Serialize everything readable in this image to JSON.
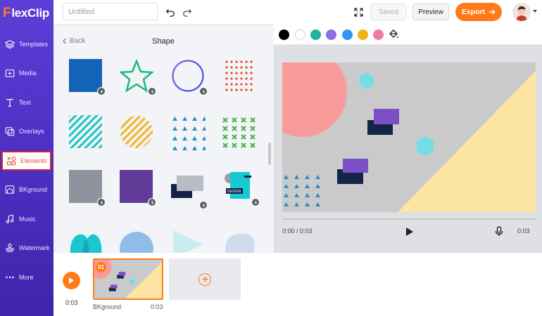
{
  "app": {
    "logo_initial": "F",
    "logo_rest": "lexClip"
  },
  "sidebar": {
    "items": [
      {
        "label": "Templates",
        "icon": "layers-icon"
      },
      {
        "label": "Media",
        "icon": "media-icon"
      },
      {
        "label": "Text",
        "icon": "text-icon"
      },
      {
        "label": "Overlays",
        "icon": "overlays-icon"
      },
      {
        "label": "Elements",
        "icon": "elements-icon",
        "active": true
      },
      {
        "label": "BKground",
        "icon": "background-icon"
      },
      {
        "label": "Music",
        "icon": "music-icon"
      },
      {
        "label": "Watermark",
        "icon": "watermark-icon"
      },
      {
        "label": "More",
        "icon": "more-icon"
      }
    ]
  },
  "topbar": {
    "title_placeholder": "Untitled",
    "undo_icon": "undo-icon",
    "redo_icon": "redo-icon",
    "fullscreen_icon": "fullscreen-icon",
    "saved_label": "Saved",
    "preview_label": "Preview",
    "export_label": "Export"
  },
  "panel": {
    "back_label": "Back",
    "title": "Shape",
    "shapes": [
      "blue-square",
      "green-star",
      "gradient-ring",
      "red-dot-grid",
      "striped-square",
      "yellow-striped-circle",
      "blue-triangle-grid",
      "green-cross-grid",
      "gray-square",
      "purple-square",
      "overlapping-rectangles",
      "design-badge",
      "teal-blob",
      "blue-circle",
      "light-triangle",
      "light-blob"
    ]
  },
  "colors": {
    "accent": "#ff7a1a",
    "sidebar": "#4b2fc2",
    "swatches": [
      "#000000",
      "#ffffff",
      "#1fb5a2",
      "#8c6fe0",
      "#2b97f1",
      "#f3b316",
      "#f17ba8"
    ]
  },
  "preview": {
    "current_time": "0:00 / 0:03",
    "duration": "0:03"
  },
  "timeline": {
    "time": "0:03",
    "clips": [
      {
        "number": "01",
        "label": "BKground",
        "duration": "0:03"
      }
    ]
  }
}
